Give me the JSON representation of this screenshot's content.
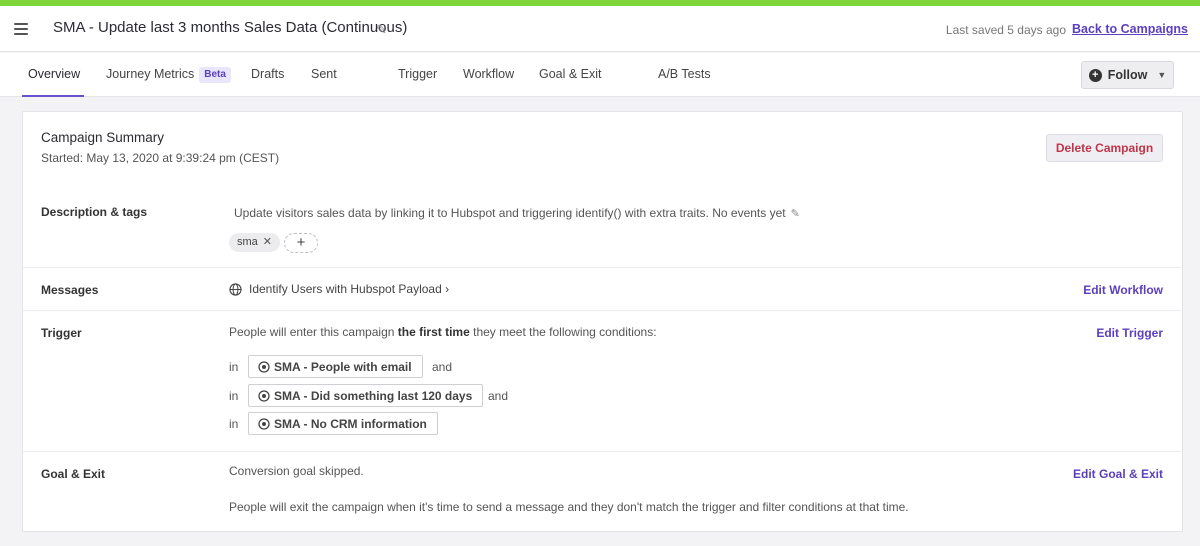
{
  "header": {
    "title": "SMA - Update last 3 months Sales Data (Continuous)",
    "last_saved": "Last saved 5 days ago",
    "back_link": "Back to Campaigns"
  },
  "tabs": [
    {
      "label": "Overview",
      "active": true
    },
    {
      "label": "Journey Metrics",
      "badge": "Beta"
    },
    {
      "label": "Drafts"
    },
    {
      "label": "Sent"
    },
    {
      "label": "Trigger"
    },
    {
      "label": "Workflow"
    },
    {
      "label": "Goal & Exit"
    },
    {
      "label": "A/B Tests"
    }
  ],
  "follow_label": "Follow",
  "summary": {
    "title": "Campaign Summary",
    "started": "Started: May 13, 2020 at 9:39:24 pm (CEST)",
    "delete_label": "Delete Campaign"
  },
  "description": {
    "label": "Description & tags",
    "text": "Update visitors sales data by linking it to Hubspot and triggering identify() with extra traits. No events yet",
    "tags": [
      "sma"
    ],
    "add_tag": "+"
  },
  "messages": {
    "label": "Messages",
    "item": "Identify Users with Hubspot Payload ›",
    "edit": "Edit Workflow"
  },
  "trigger": {
    "label": "Trigger",
    "text_before": "People will enter this campaign ",
    "text_bold": "the first time",
    "text_after": " they meet the following conditions:",
    "edit": "Edit Trigger",
    "in_label": "in",
    "and_label": "and",
    "conditions": [
      "SMA - People with email",
      "SMA - Did something last 120 days",
      "SMA - No CRM information"
    ]
  },
  "goal": {
    "label": "Goal & Exit",
    "conversion": "Conversion goal skipped.",
    "exit_text": "People will exit the campaign when it's time to send a message and they don't match the trigger and filter conditions at that time.",
    "edit": "Edit Goal & Exit"
  },
  "colors": {
    "accent": "#5b3fbf",
    "top_bar": "#7ed63b",
    "danger": "#c0354a"
  }
}
